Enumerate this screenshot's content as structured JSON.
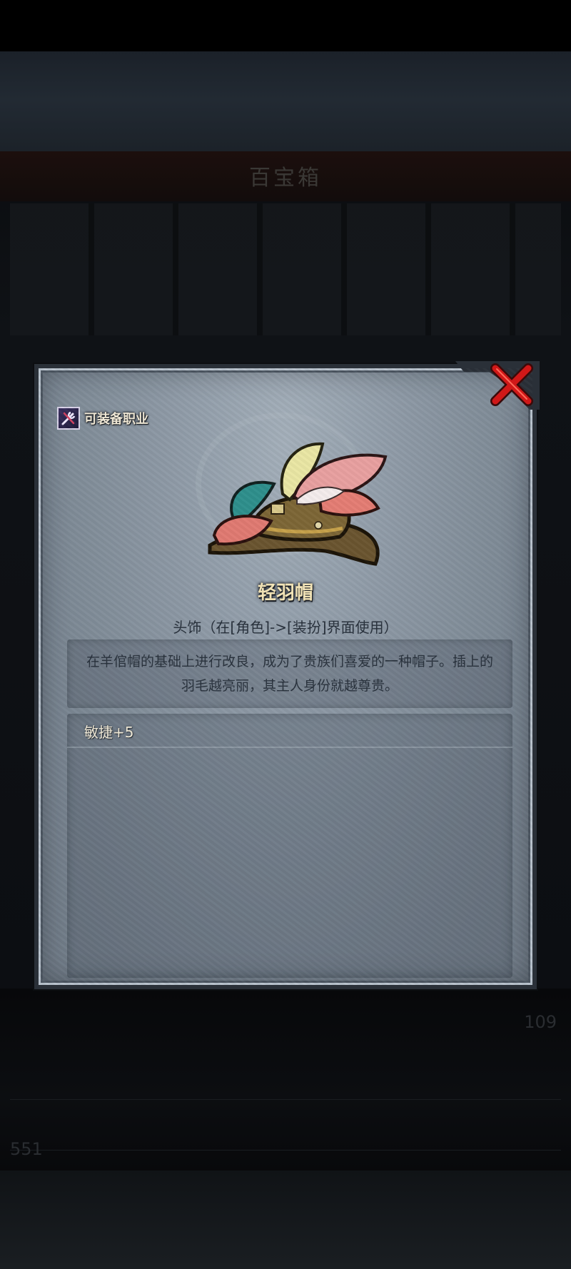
{
  "background": {
    "title": "百宝箱",
    "bottom_left_text": "551",
    "bottom_right_text": "109"
  },
  "dialog": {
    "close_icon": "close-x-icon",
    "job_badge": {
      "icon": "crossed-tools-icon",
      "label": "可装备职业"
    },
    "item": {
      "image": "feathered-hat-icon",
      "name": "轻羽帽",
      "type_line": "头饰（在[角色]->[装扮]界面使用）",
      "description": "在羊倌帽的基础上进行改良，成为了贵族们喜爱的一种帽子。插上的羽毛越亮丽，其主人身份就越尊贵。",
      "stats": [
        "敏捷+5"
      ]
    }
  },
  "colors": {
    "title_gold": "#f5e6b8",
    "close_red": "#d01818",
    "panel_gray": "#8d99a5"
  }
}
